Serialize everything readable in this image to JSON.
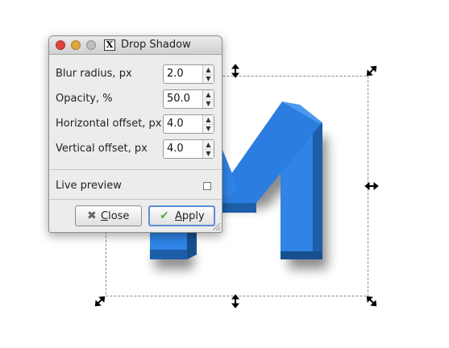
{
  "dialog": {
    "title": "Drop Shadow",
    "app_icon_glyph": "X",
    "fields": [
      {
        "label": "Blur radius, px",
        "value": "2.0"
      },
      {
        "label": "Opacity, %",
        "value": "50.0"
      },
      {
        "label": "Horizontal offset, px",
        "value": "4.0"
      },
      {
        "label": "Vertical offset, px",
        "value": "4.0"
      }
    ],
    "live_preview_label": "Live preview",
    "live_preview_checked": false,
    "close": {
      "first": "C",
      "rest": "lose"
    },
    "apply": {
      "first": "A",
      "rest": "pply"
    }
  },
  "colors": {
    "logo_face": "#2f84e6",
    "logo_dark": "#1c5ea8",
    "close_traffic": "#e0443e",
    "minimize_traffic": "#e2a73c",
    "zoom_traffic": "#bfbfbf",
    "apply_check": "#5aa93a",
    "close_x": "#666666"
  },
  "icons": [
    "close-traffic-light",
    "minimize-traffic-light",
    "zoom-traffic-light",
    "x11-app-icon",
    "close-x-icon",
    "apply-check-icon",
    "resize-grip-icon",
    "scale-handle-icon"
  ]
}
